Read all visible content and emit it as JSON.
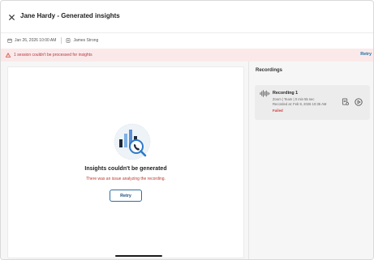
{
  "header": {
    "title": "Jane Hardy - Generated insights"
  },
  "meta": {
    "date": "Jan 26, 2026 10:00 AM",
    "owner": "James Strong"
  },
  "alert": {
    "message": "1 session couldn't be processed for insights",
    "retry_label": "Retry"
  },
  "main": {
    "empty_title": "Insights couldn't be generated",
    "empty_subtitle": "There was an issue analyzing the recording.",
    "retry_label": "Retry"
  },
  "recordings": {
    "title": "Recordings",
    "items": [
      {
        "name": "Recording 1",
        "source": "Zoom | Team | 0 min 55 sec",
        "recorded": "Recorded at: Feb 9, 2026 10:35 AM",
        "status": "Failed"
      }
    ]
  },
  "colors": {
    "alert_bg": "#fbe9ea",
    "alert_text": "#b3383e",
    "accent": "#1a6fa3",
    "error": "#d23c3c"
  }
}
